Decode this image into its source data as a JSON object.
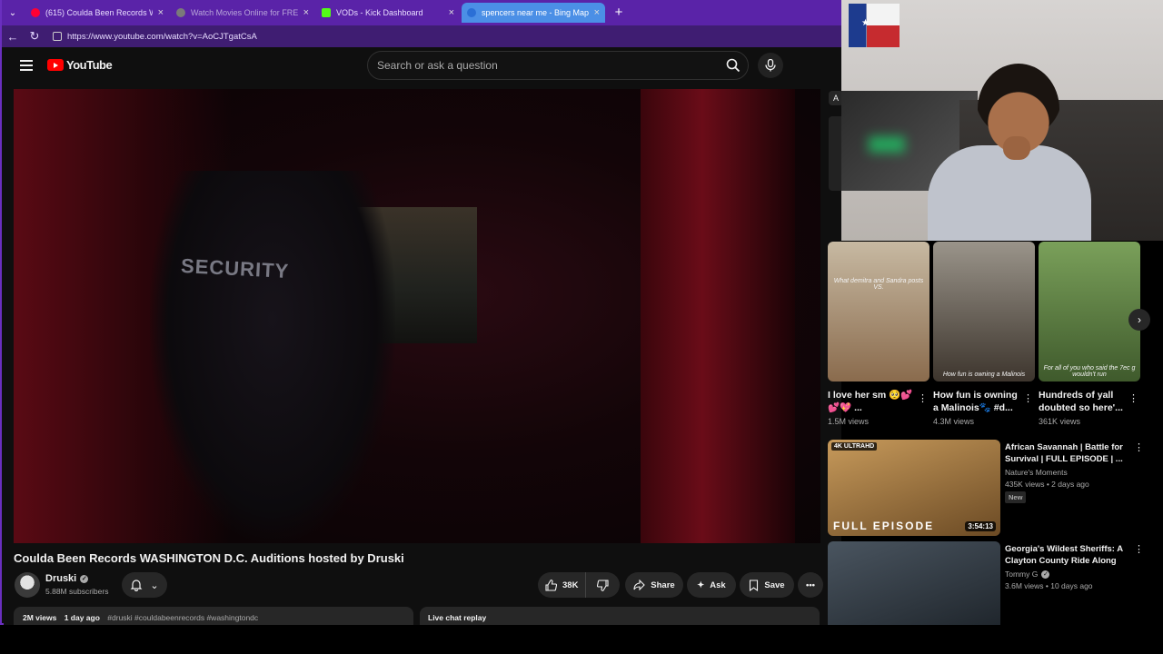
{
  "browser": {
    "tabs": [
      {
        "label": "(615) Coulda Been Records W",
        "favicon_color": "#ff0033",
        "active": false
      },
      {
        "label": "Watch Movies Online for FREE | 1",
        "favicon_color": "#7a7a7a",
        "active": false
      },
      {
        "label": "VODs - Kick Dashboard",
        "favicon_color": "#53fc18",
        "active": false
      },
      {
        "label": "spencers near me - Bing Maps",
        "favicon_color": "#2b6fd6",
        "active": true
      }
    ],
    "url": "https://www.youtube.com/watch?v=AoCJTgatCsA",
    "accent": "#5a23a8"
  },
  "youtube": {
    "logo_text": "YouTube",
    "search_placeholder": "Search or ask a question",
    "video": {
      "overlay_text": "SECURITY",
      "title": "Coulda Been Records WASHINGTON D.C. Auditions hosted by Druski",
      "channel": "Druski",
      "subscribers": "5.88M subscribers",
      "likes": "38K",
      "share_label": "Share",
      "ask_label": "Ask",
      "save_label": "Save",
      "views": "2M views",
      "posted": "1 day ago",
      "tags": "#druski #couldabeenrecords #washingtondc",
      "live_chat_label": "Live chat replay"
    },
    "sidebar": {
      "chip_letter": "A",
      "shorts": [
        {
          "title": "I love her sm 🥺💕💕💖 ...",
          "views": "1.5M views",
          "caption": "What demitra and Sandra posts VS.",
          "thumb_a": "#c7b9a2",
          "thumb_b": "#8a6b4d"
        },
        {
          "title": "How fun is owning a Malinois🐾 #d...",
          "views": "4.3M views",
          "caption": "How fun is owning a Malinois",
          "thumb_a": "#9a948a",
          "thumb_b": "#3d352d"
        },
        {
          "title": "Hundreds of yall doubted so here'...",
          "views": "361K views",
          "caption": "For all of you who said the 7ec g wouldn't run",
          "thumb_a": "#7aa05a",
          "thumb_b": "#3f5a2c"
        }
      ],
      "videos": [
        {
          "title": "African Savannah | Battle for Survival | FULL EPISODE | ...",
          "channel": "Nature's Moments",
          "meta": "435K views • 2 days ago",
          "badge_new": "New",
          "duration": "3:54:13",
          "thumb_badge": "4K ULTRAHD",
          "overlay": "FULL EPISODE",
          "thumb_a": "#c79a5b",
          "thumb_b": "#6b4a24"
        },
        {
          "title": "Georgia's Wildest Sheriffs: A Clayton County Ride Along",
          "channel": "Tommy G",
          "meta": "3.6M views • 10 days ago",
          "thumb_a": "#4a5560",
          "thumb_b": "#1c2228"
        }
      ]
    }
  }
}
